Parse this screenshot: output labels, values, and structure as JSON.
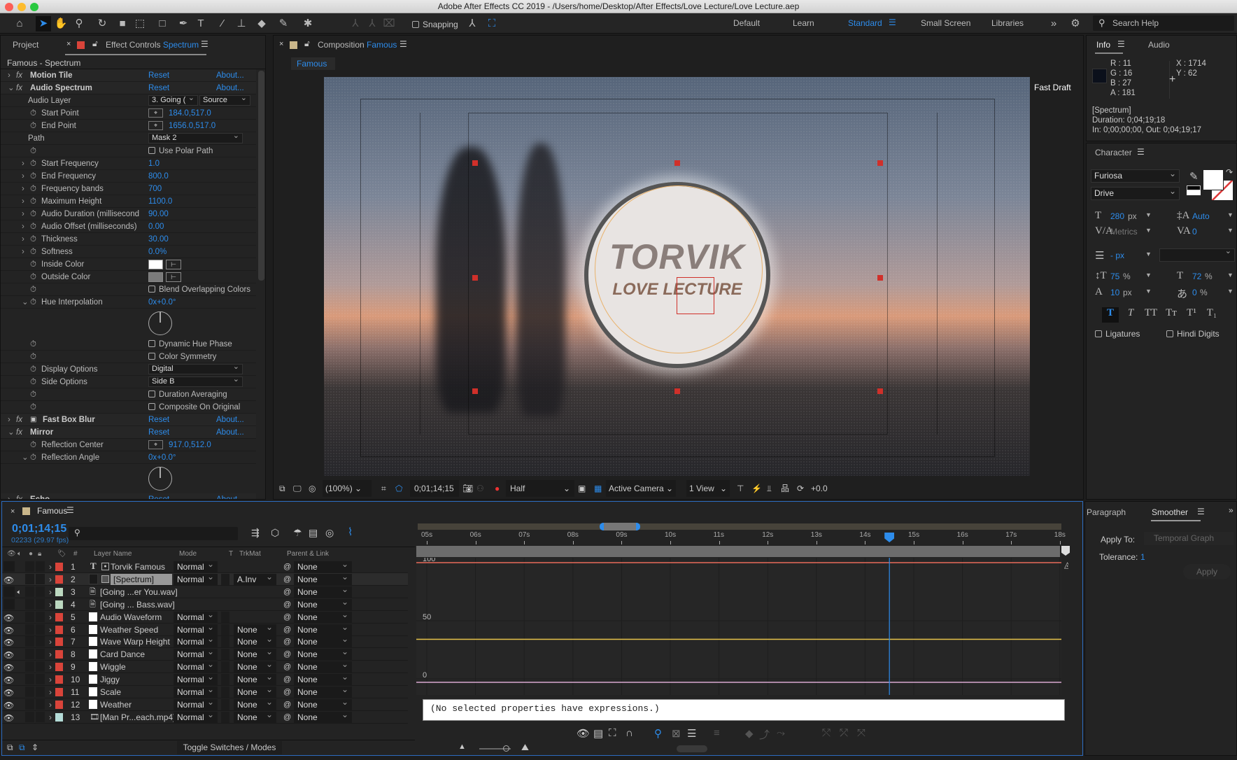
{
  "window": {
    "title": "Adobe After Effects CC 2019 - /Users/home/Desktop/After Effects/Love Lecture/Love Lecture.aep"
  },
  "toolbar": {
    "snapping_label": "Snapping",
    "workspaces": [
      "Default",
      "Learn",
      "Standard",
      "Small Screen",
      "Libraries"
    ],
    "active_workspace": "Standard",
    "search_placeholder": "Search Help"
  },
  "left_panel": {
    "tab_project": "Project",
    "tab_effect_controls": "Effect Controls",
    "tab_layer": "Spectrum",
    "header": "Famous - Spectrum",
    "rows": [
      {
        "kind": "fx",
        "label": "Motion Tile",
        "reset": "Reset",
        "about": "About...",
        "collapsed": true
      },
      {
        "kind": "fx",
        "label": "Audio Spectrum",
        "reset": "Reset",
        "about": "About...",
        "collapsed": false
      },
      {
        "kind": "layer",
        "label": "Audio Layer",
        "value": "3. Going (",
        "value2": "Source"
      },
      {
        "kind": "point",
        "label": "Start Point",
        "value": "184.0,517.0"
      },
      {
        "kind": "point",
        "label": "End Point",
        "value": "1656.0,517.0"
      },
      {
        "kind": "dropdown",
        "label": "Path",
        "value": "Mask 2",
        "nostop": true
      },
      {
        "kind": "check",
        "label": "Use Polar Path"
      },
      {
        "kind": "num",
        "label": "Start Frequency",
        "value": "1.0"
      },
      {
        "kind": "num",
        "label": "End Frequency",
        "value": "800.0"
      },
      {
        "kind": "num",
        "label": "Frequency bands",
        "value": "700"
      },
      {
        "kind": "num",
        "label": "Maximum Height",
        "value": "1100.0"
      },
      {
        "kind": "num",
        "label": "Audio Duration (millisecond",
        "value": "90.00"
      },
      {
        "kind": "num",
        "label": "Audio Offset (milliseconds)",
        "value": "0.00"
      },
      {
        "kind": "num",
        "label": "Thickness",
        "value": "30.00"
      },
      {
        "kind": "num",
        "label": "Softness",
        "value": "0.0%"
      },
      {
        "kind": "color",
        "label": "Inside Color",
        "color": "#ffffff"
      },
      {
        "kind": "color",
        "label": "Outside Color",
        "color": "#7a7a7a"
      },
      {
        "kind": "check",
        "label": "Blend Overlapping Colors"
      },
      {
        "kind": "angle",
        "label": "Hue Interpolation",
        "value": "0x+0.0°"
      },
      {
        "kind": "check",
        "label": "Dynamic Hue Phase"
      },
      {
        "kind": "check",
        "label": "Color Symmetry"
      },
      {
        "kind": "dropdown",
        "label": "Display Options",
        "value": "Digital"
      },
      {
        "kind": "dropdown",
        "label": "Side Options",
        "value": "Side B"
      },
      {
        "kind": "check",
        "label": "Duration Averaging"
      },
      {
        "kind": "check",
        "label": "Composite On Original"
      },
      {
        "kind": "fx",
        "label": "Fast Box Blur",
        "reset": "Reset",
        "about": "About...",
        "collapsed": true,
        "badge": true
      },
      {
        "kind": "fx",
        "label": "Mirror",
        "reset": "Reset",
        "about": "About...",
        "collapsed": false
      },
      {
        "kind": "point",
        "label": "Reflection Center",
        "value": "917.0,512.0"
      },
      {
        "kind": "angle",
        "label": "Reflection Angle",
        "value": "0x+0.0°"
      },
      {
        "kind": "fx",
        "label": "Echo",
        "reset": "Reset",
        "about": "About...",
        "collapsed": true
      }
    ]
  },
  "composition": {
    "tab_label": "Composition",
    "comp_name": "Famous",
    "subtab": "Famous",
    "fast_draft": "Fast Draft",
    "logo_text_1": "TORVIK",
    "logo_text_2": "LOVE LECTURE",
    "viewer_toolbar": {
      "zoom": "(100%)",
      "timecode": "0;01;14;15",
      "resolution": "Half",
      "camera": "Active Camera",
      "views": "1 View",
      "exposure": "+0.0"
    }
  },
  "info": {
    "tab_info": "Info",
    "tab_audio": "Audio",
    "r": "R : 11",
    "g": "G : 16",
    "b": "B : 27",
    "a": "A : 181",
    "x": "X : 1714",
    "y": "Y : 62",
    "swatch": "#0b101b",
    "layer": "[Spectrum]",
    "duration": "Duration: 0;04;19;18",
    "inout": "In: 0;00;00;00, Out: 0;04;19;17"
  },
  "character": {
    "title": "Character",
    "font": "Furiosa",
    "style": "Drive",
    "size": "280",
    "size_unit": "px",
    "leading": "Auto",
    "kerning": "Metrics",
    "tracking": "0",
    "stroke": "- px",
    "vscale": "75",
    "hscale": "72",
    "baseline": "10",
    "tsume": "0",
    "pct": "%",
    "px": "px",
    "ligatures": "Ligatures",
    "hindi": "Hindi Digits",
    "style_buttons": [
      "T",
      "T",
      "TT",
      "Tт",
      "T¹",
      "T₁"
    ]
  },
  "timeline": {
    "tab": "Famous",
    "timecode": "0;01;14;15",
    "frames": "02233 (29.97 fps)",
    "headers": {
      "num": "#",
      "name": "Layer Name",
      "mode": "Mode",
      "t": "T",
      "trkmat": "TrkMat",
      "parent": "Parent & Link"
    },
    "layers": [
      {
        "n": "1",
        "name": "Torvik Famous",
        "type": "text",
        "label": "#d9443a",
        "mode": "Normal",
        "trkmat": "",
        "parent": "None",
        "eye": false
      },
      {
        "n": "2",
        "name": "[Spectrum]",
        "type": "solid",
        "label": "#d9443a",
        "mode": "Normal",
        "trkmat": "A.Inv",
        "parent": "None",
        "eye": true,
        "selected": true
      },
      {
        "n": "3",
        "name": "[Going ...er You.wav]",
        "type": "audio",
        "label": "#bcd8c0",
        "mode": "",
        "trkmat": "",
        "parent": "None",
        "eye": false,
        "audio": true
      },
      {
        "n": "4",
        "name": "[Going ... Bass.wav]",
        "type": "audio",
        "label": "#bcd8c0",
        "mode": "",
        "trkmat": "",
        "parent": "None",
        "eye": false
      },
      {
        "n": "5",
        "name": "Audio Waveform",
        "type": "white",
        "label": "#d9443a",
        "mode": "Normal",
        "trkmat": "",
        "parent": "None",
        "eye": true
      },
      {
        "n": "6",
        "name": "Weather Speed",
        "type": "white",
        "label": "#d9443a",
        "mode": "Normal",
        "trkmat": "None",
        "parent": "None",
        "eye": true
      },
      {
        "n": "7",
        "name": "Wave Warp Height",
        "type": "white",
        "label": "#d9443a",
        "mode": "Normal",
        "trkmat": "None",
        "parent": "None",
        "eye": true
      },
      {
        "n": "8",
        "name": "Card Dance",
        "type": "white",
        "label": "#d9443a",
        "mode": "Normal",
        "trkmat": "None",
        "parent": "None",
        "eye": true
      },
      {
        "n": "9",
        "name": "Wiggle",
        "type": "white",
        "label": "#d9443a",
        "mode": "Normal",
        "trkmat": "None",
        "parent": "None",
        "eye": true
      },
      {
        "n": "10",
        "name": "Jiggy",
        "type": "white",
        "label": "#d9443a",
        "mode": "Normal",
        "trkmat": "None",
        "parent": "None",
        "eye": true
      },
      {
        "n": "11",
        "name": "Scale",
        "type": "white",
        "label": "#d9443a",
        "mode": "Normal",
        "trkmat": "None",
        "parent": "None",
        "eye": true
      },
      {
        "n": "12",
        "name": "Weather",
        "type": "white",
        "label": "#d9443a",
        "mode": "Normal",
        "trkmat": "None",
        "parent": "None",
        "eye": true
      },
      {
        "n": "13",
        "name": "[Man Pr...each.mp4]",
        "type": "footage",
        "label": "#b4dcd8",
        "mode": "Normal",
        "trkmat": "None",
        "parent": "None",
        "eye": true
      }
    ],
    "toggle_label": "Toggle Switches / Modes",
    "ruler": [
      "05s",
      "06s",
      "07s",
      "08s",
      "09s",
      "10s",
      "11s",
      "12s",
      "13s",
      "14s",
      "15s",
      "16s",
      "17s",
      "18s"
    ],
    "playhead_seconds": 14.5,
    "graph": {
      "labels": [
        "100",
        "50",
        "0"
      ],
      "red_value": 100,
      "yellow_value": 34,
      "pink_value": -3
    },
    "expression_message": "(No selected properties have expressions.)"
  },
  "smoother": {
    "tab_paragraph": "Paragraph",
    "tab_smoother": "Smoother",
    "apply_to_label": "Apply To:",
    "apply_to_value": "Temporal Graph",
    "tolerance_label": "Tolerance:",
    "tolerance_value": "1",
    "apply": "Apply"
  }
}
